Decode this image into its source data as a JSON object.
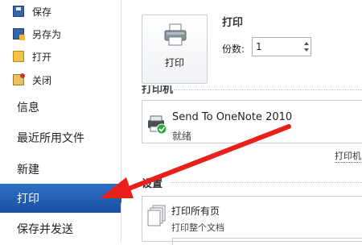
{
  "sidebar": {
    "small_items": [
      {
        "label": "保存",
        "icon": "save-icon"
      },
      {
        "label": "另存为",
        "icon": "save-as-icon"
      },
      {
        "label": "打开",
        "icon": "open-folder-icon"
      },
      {
        "label": "关闭",
        "icon": "close-folder-icon"
      }
    ],
    "items": [
      {
        "label": "信息"
      },
      {
        "label": "最近所用文件"
      },
      {
        "label": "新建"
      },
      {
        "label": "打印",
        "active": true
      },
      {
        "label": "保存并发送"
      }
    ],
    "active_color": "#1e58aa"
  },
  "print": {
    "section_title": "打印",
    "button_label": "打印",
    "copies_label": "份数:",
    "copies_value": "1"
  },
  "printer": {
    "header_partial": "打印机",
    "name": "Send To OneNote 2010",
    "status": "就绪",
    "properties_link": "打印机"
  },
  "settings": {
    "header": "设置",
    "range_title": "打印所有页",
    "range_subtitle": "打印整个文档"
  },
  "annotation": {
    "arrow_color": "#e8201a"
  }
}
